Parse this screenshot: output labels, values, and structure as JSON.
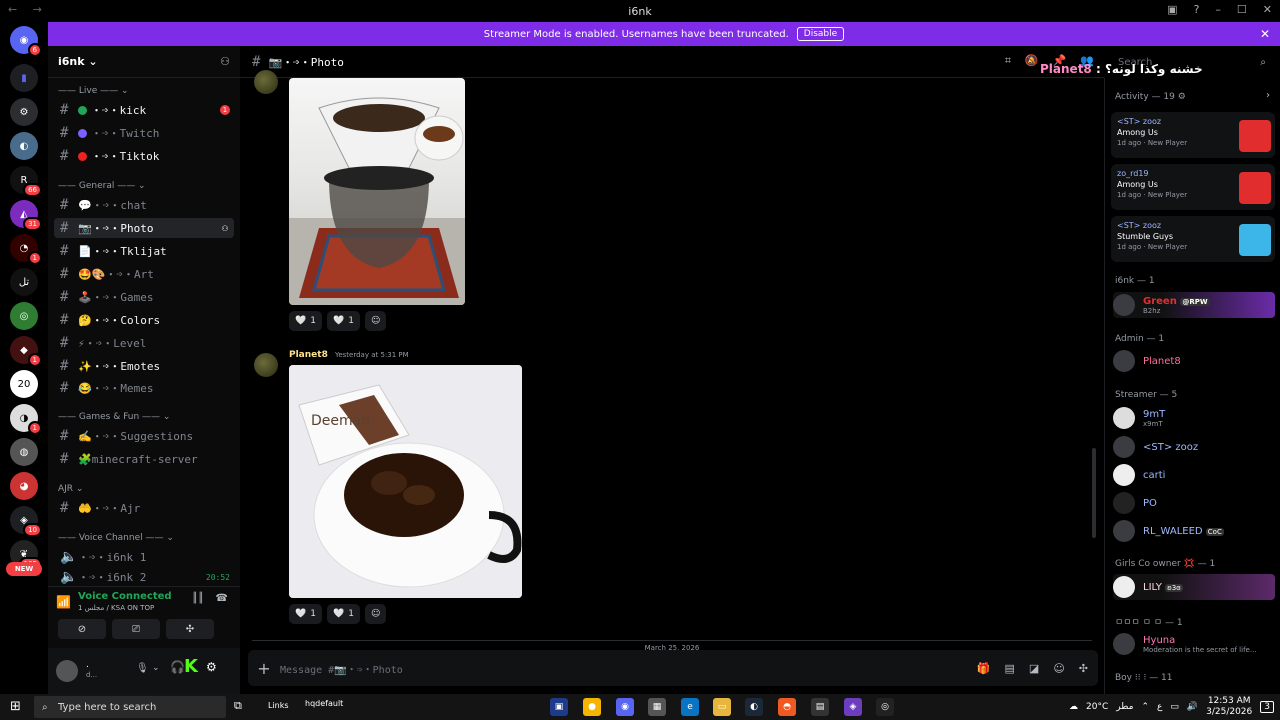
{
  "window": {
    "title": "i6nk",
    "nav": "← →"
  },
  "banner": {
    "text": "Streamer Mode is enabled. Usernames have been truncated.",
    "disable_label": "Disable",
    "close": "✕"
  },
  "server_badges": [
    "6",
    "66",
    "31",
    "1",
    "1",
    "1",
    "10",
    "102"
  ],
  "new_label": "NEW",
  "guild": {
    "name": "i6nk ⌄",
    "add_icon": "person-add-icon"
  },
  "categories": {
    "live": "—— Live —— ⌄",
    "general": "—— General —— ⌄",
    "games": "—— Games & Fun —— ⌄",
    "ajr": "AJR ⌄",
    "voice": "—— Voice Channel —— ⌄"
  },
  "channels": [
    {
      "name": "・➩・kick",
      "unread": true,
      "badge": "1",
      "color": "#23a559"
    },
    {
      "name": "・➩・Twitch",
      "color": "#7b61ff"
    },
    {
      "name": "・➩・Tiktok",
      "unread": true,
      "color": "#e22"
    },
    {
      "name": "・➩・chat",
      "emoji": "💬"
    },
    {
      "name": "・➩・Photo",
      "emoji": "📷",
      "active": true
    },
    {
      "name": "・➩・Tklijat",
      "emoji": "📄",
      "unread": true
    },
    {
      "name": "・➩・Art",
      "emoji": "🤩🎨"
    },
    {
      "name": "・➩・Games",
      "emoji": "🕹️"
    },
    {
      "name": "・➩・Colors",
      "emoji": "🤔",
      "unread": true
    },
    {
      "name": "・➩・Level",
      "emoji": "⚡"
    },
    {
      "name": "・➩・Emotes",
      "emoji": "✨",
      "unread": true
    },
    {
      "name": "・➩・Memes",
      "emoji": "😂"
    },
    {
      "name": "・➩・Suggestions",
      "emoji": "✍️"
    },
    {
      "name": "minecraft-server",
      "emoji": "🧩"
    },
    {
      "name": "・➩・Ajr",
      "emoji": "🤲"
    }
  ],
  "voice_channels": [
    {
      "name": "・➩・i6nk 1"
    },
    {
      "name": "・➩・i6nk 2",
      "time": "20:52"
    }
  ],
  "voice": {
    "status": "Voice Connected",
    "sub": "مجلس 1 / KSA ON TOP"
  },
  "user": {
    "name": ".",
    "status": "d..."
  },
  "chat": {
    "channel": "📷・➩・Photo",
    "messages": [
      {
        "author": "Planet8",
        "time": "Yesterday at 5:31 PM"
      }
    ],
    "reactions": [
      "🤍",
      "1",
      "🤍",
      "1",
      "☺"
    ],
    "img_text": "Deeman",
    "date_separator": "March 25, 2026",
    "placeholder": "Message #📷・➩・Photo"
  },
  "overlay": {
    "name": "Planet8",
    "text": ": خشنه وكذا لونه؟"
  },
  "search_placeholder": "Search",
  "activity": {
    "header": "Activity — 19 ⚙",
    "cards": [
      {
        "user": "<ST> zooz",
        "game": "Among Us",
        "meta": "1d ago · New Player",
        "color": "#e12d2d"
      },
      {
        "user": "zo_rd19",
        "game": "Among Us",
        "meta": "1d ago · New Player",
        "color": "#e12d2d"
      },
      {
        "user": "<ST> zooz",
        "game": "Stumble Guys",
        "meta": "1d ago · New Player",
        "color": "#3cb5e8"
      }
    ]
  },
  "member_groups": [
    {
      "header": "i6nk — 1",
      "members": [
        {
          "name": "Green",
          "tag": "@RPW",
          "status": "B2hz",
          "color": "#e03131"
        }
      ]
    },
    {
      "header": "Admin — 1",
      "members": [
        {
          "name": "Planet8",
          "color": "#ff6b9e"
        }
      ]
    },
    {
      "header": "Streamer — 5",
      "members": [
        {
          "name": "9mT",
          "status": "x9mT",
          "color": "#9fb8ff"
        },
        {
          "name": "<ST> zooz",
          "color": "#9fb8ff"
        },
        {
          "name": "carti",
          "color": "#9fb8ff"
        },
        {
          "name": "PO",
          "color": "#9fb8ff"
        },
        {
          "name": "RL_WALEED",
          "tag": "CoC",
          "color": "#9fb8ff"
        }
      ]
    },
    {
      "header": "Girls Co owner 💢 — 1",
      "members": [
        {
          "name": "LILY",
          "tag": "ʚ3ɞ",
          "color": "#ffd6e8"
        }
      ]
    },
    {
      "header": "ㅁㅁㅁ ㅁ ㅁ — 1",
      "members": [
        {
          "name": "Hyuna",
          "status": "Moderation is the secret of life...",
          "color": "#ff7ab6"
        }
      ]
    },
    {
      "header": "Boy ⁝⁝ ⁝ — 11",
      "members": []
    }
  ],
  "taskbar": {
    "search": "Type here to search",
    "links": "Links",
    "hqdefault": "hqdefault",
    "temp": "20°C",
    "weather": "مطر",
    "lang": "ع",
    "time": "12:53 AM",
    "date": "3/25/2026",
    "notif": "3"
  }
}
